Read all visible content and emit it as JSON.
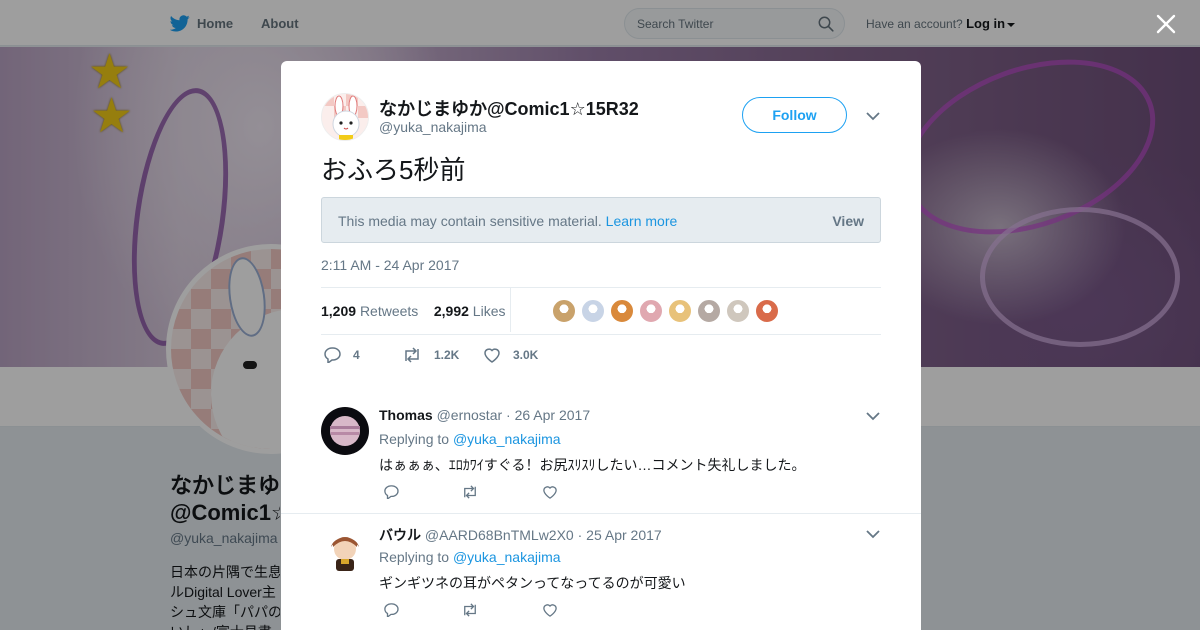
{
  "topbar": {
    "home_label": "Home",
    "about_label": "About",
    "search_placeholder": "Search Twitter",
    "account_prompt": "Have an account?",
    "login_label": "Log in"
  },
  "profile": {
    "name_line1": "なかじまゆか",
    "name_line2": "@Comic1☆",
    "handle": "@yuka_nakajima",
    "bio_lines": [
      "日本の片隅で生息",
      "ルDigital Lover主",
      "シュ文庫「パパの",
      "いし」/富士見書"
    ]
  },
  "tweet": {
    "display_name": "なかじまゆか@Comic1☆15R32",
    "handle": "@yuka_nakajima",
    "follow_label": "Follow",
    "text": "おふろ5秒前",
    "sensitive_message": "This media may contain sensitive material.",
    "learn_more": "Learn more",
    "view_label": "View",
    "timestamp": "2:11 AM - 24 Apr 2017",
    "retweets_count": "1,209",
    "retweets_label": "Retweets",
    "likes_count": "2,992",
    "likes_label": "Likes",
    "reply_count": "4",
    "retweet_short": "1.2K",
    "like_short": "3.0K",
    "liker_colors": [
      "#c9a26b",
      "#c8d4e6",
      "#d9893b",
      "#e0a8b0",
      "#e8c27a",
      "#b5a9a3",
      "#cfc7bd",
      "#d96b4a"
    ]
  },
  "replies": [
    {
      "name": "Thomas",
      "handle": "@ernostar",
      "date": "· 26 Apr 2017",
      "replying_prefix": "Replying to",
      "replying_to": "@yuka_nakajima",
      "text": "はぁぁぁ、ｴﾛｶﾜｲすぐる！お尻ｽﾘｽﾘしたい…コメント失礼しました。"
    },
    {
      "name": "バウル",
      "handle": "@AARD68BnTMLw2X0",
      "date": "· 25 Apr 2017",
      "replying_prefix": "Replying to",
      "replying_to": "@yuka_nakajima",
      "text": "ギンギツネの耳がペタンってなってるのが可愛い"
    }
  ],
  "colors": {
    "accent": "#1da1f2",
    "link": "#1b95e0",
    "muted": "#657786"
  }
}
